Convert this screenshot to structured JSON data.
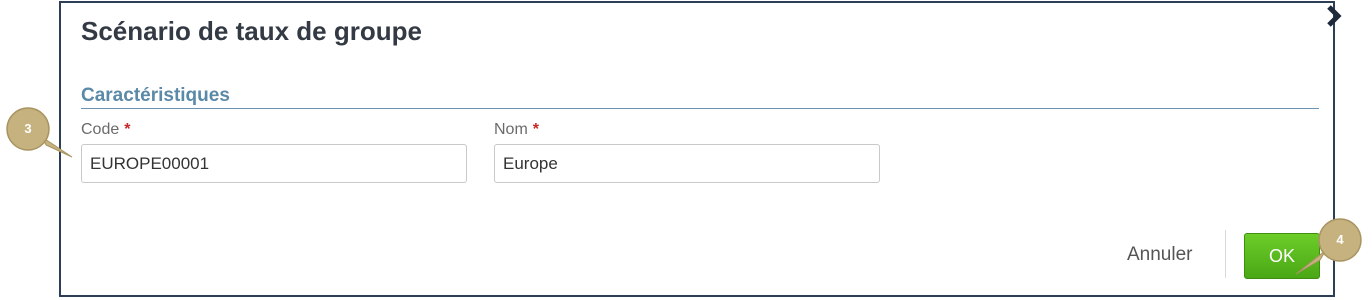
{
  "dialog": {
    "title": "Scénario de taux de groupe",
    "close_icon": "chevron-right-icon"
  },
  "section": {
    "title": "Caractéristiques"
  },
  "fields": {
    "code": {
      "label": "Code",
      "required_mark": "*",
      "value": "EUROPE00001"
    },
    "nom": {
      "label": "Nom",
      "required_mark": "*",
      "value": "Europe"
    }
  },
  "footer": {
    "cancel_label": "Annuler",
    "ok_label": "OK"
  },
  "callouts": {
    "step3": "3",
    "step4": "4"
  },
  "colors": {
    "dialog_border": "#2d3e57",
    "section_title": "#5b89a8",
    "required": "#c62828",
    "ok_button": "#58b51b",
    "callout": "#c5b27e"
  }
}
